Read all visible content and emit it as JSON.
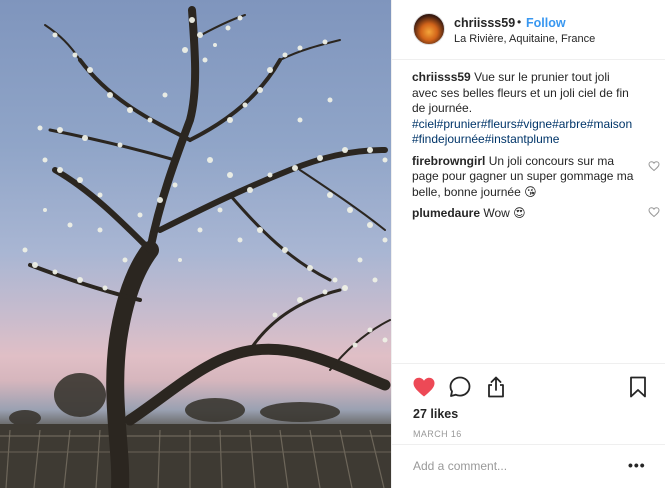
{
  "header": {
    "username": "chriisss59",
    "separator": "•",
    "follow_label": "Follow",
    "location": "La Rivière, Aquitaine, France"
  },
  "caption": {
    "username": "chriisss59",
    "text": "Vue sur le prunier tout joli avec ses belles fleurs et un joli ciel de fin de journée.",
    "hashtags": "#ciel#prunier#fleurs#vigne#arbre#maison#findejournée#instantplume"
  },
  "comments": [
    {
      "username": "firebrowngirl",
      "text": "Un joli concours sur ma page pour gagner un super gommage ma belle, bonne journée 😘"
    },
    {
      "username": "plumedaure",
      "text": "Wow 😍"
    }
  ],
  "actions": {
    "likes": "27 likes",
    "date": "MARCH 16",
    "liked": true,
    "like_color": "#ed4956"
  },
  "add_comment": {
    "placeholder": "Add a comment...",
    "more_label": "•••"
  },
  "icons": {
    "like": "heart-icon",
    "comment": "comment-icon",
    "share": "share-icon",
    "save": "bookmark-icon",
    "comment_like": "heart-outline-icon"
  },
  "colors": {
    "link": "#3897f0",
    "hashtag": "#003569",
    "muted": "#999999"
  }
}
